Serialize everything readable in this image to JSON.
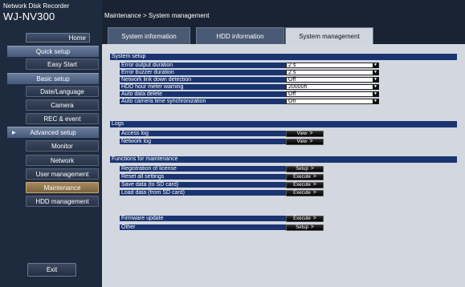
{
  "brand": {
    "small": "Network Disk Recorder",
    "model": "WJ-NV300"
  },
  "sidebar": {
    "home": "Home",
    "items": [
      {
        "label": "Quick setup"
      },
      {
        "label": "Easy Start"
      },
      {
        "label": "Basic setup"
      },
      {
        "label": "Date/Language"
      },
      {
        "label": "Camera"
      },
      {
        "label": "REC & event"
      },
      {
        "label": "Advanced setup"
      },
      {
        "label": "Monitor"
      },
      {
        "label": "Network"
      },
      {
        "label": "User management"
      },
      {
        "label": "Maintenance"
      },
      {
        "label": "HDD management"
      }
    ],
    "exit": "Exit"
  },
  "breadcrumb": "Maintenance > System management",
  "tabs": [
    {
      "label": "System information"
    },
    {
      "label": "HDD information"
    },
    {
      "label": "System management"
    }
  ],
  "system_setup": {
    "title": "System setup",
    "rows": [
      {
        "label": "Error output duration",
        "value": "2 s"
      },
      {
        "label": "Error buzzer duration",
        "value": "2 s"
      },
      {
        "label": "Network link down detection",
        "value": "Off"
      },
      {
        "label": "HDD hour meter warning",
        "value": "20000h"
      },
      {
        "label": "Auto data delete",
        "value": "Off"
      },
      {
        "label": "Auto camera time synchronization",
        "value": "On"
      }
    ]
  },
  "logs": {
    "title": "Logs",
    "rows": [
      {
        "label": "Access log",
        "button": "View"
      },
      {
        "label": "Network log",
        "button": "View"
      }
    ]
  },
  "maintenance": {
    "title": "Functions for maintenance",
    "rows": [
      {
        "label": "Registration of license",
        "button": "Setup"
      },
      {
        "label": "Reset all settings",
        "button": "Execute"
      },
      {
        "label": "Save data (to SD card)",
        "button": "Execute"
      },
      {
        "label": "Load data (from SD card)",
        "button": "Execute"
      }
    ],
    "extra_rows": [
      {
        "label": "Firmware update",
        "button": "Execute"
      },
      {
        "label": "Other",
        "button": "Setup"
      }
    ]
  }
}
